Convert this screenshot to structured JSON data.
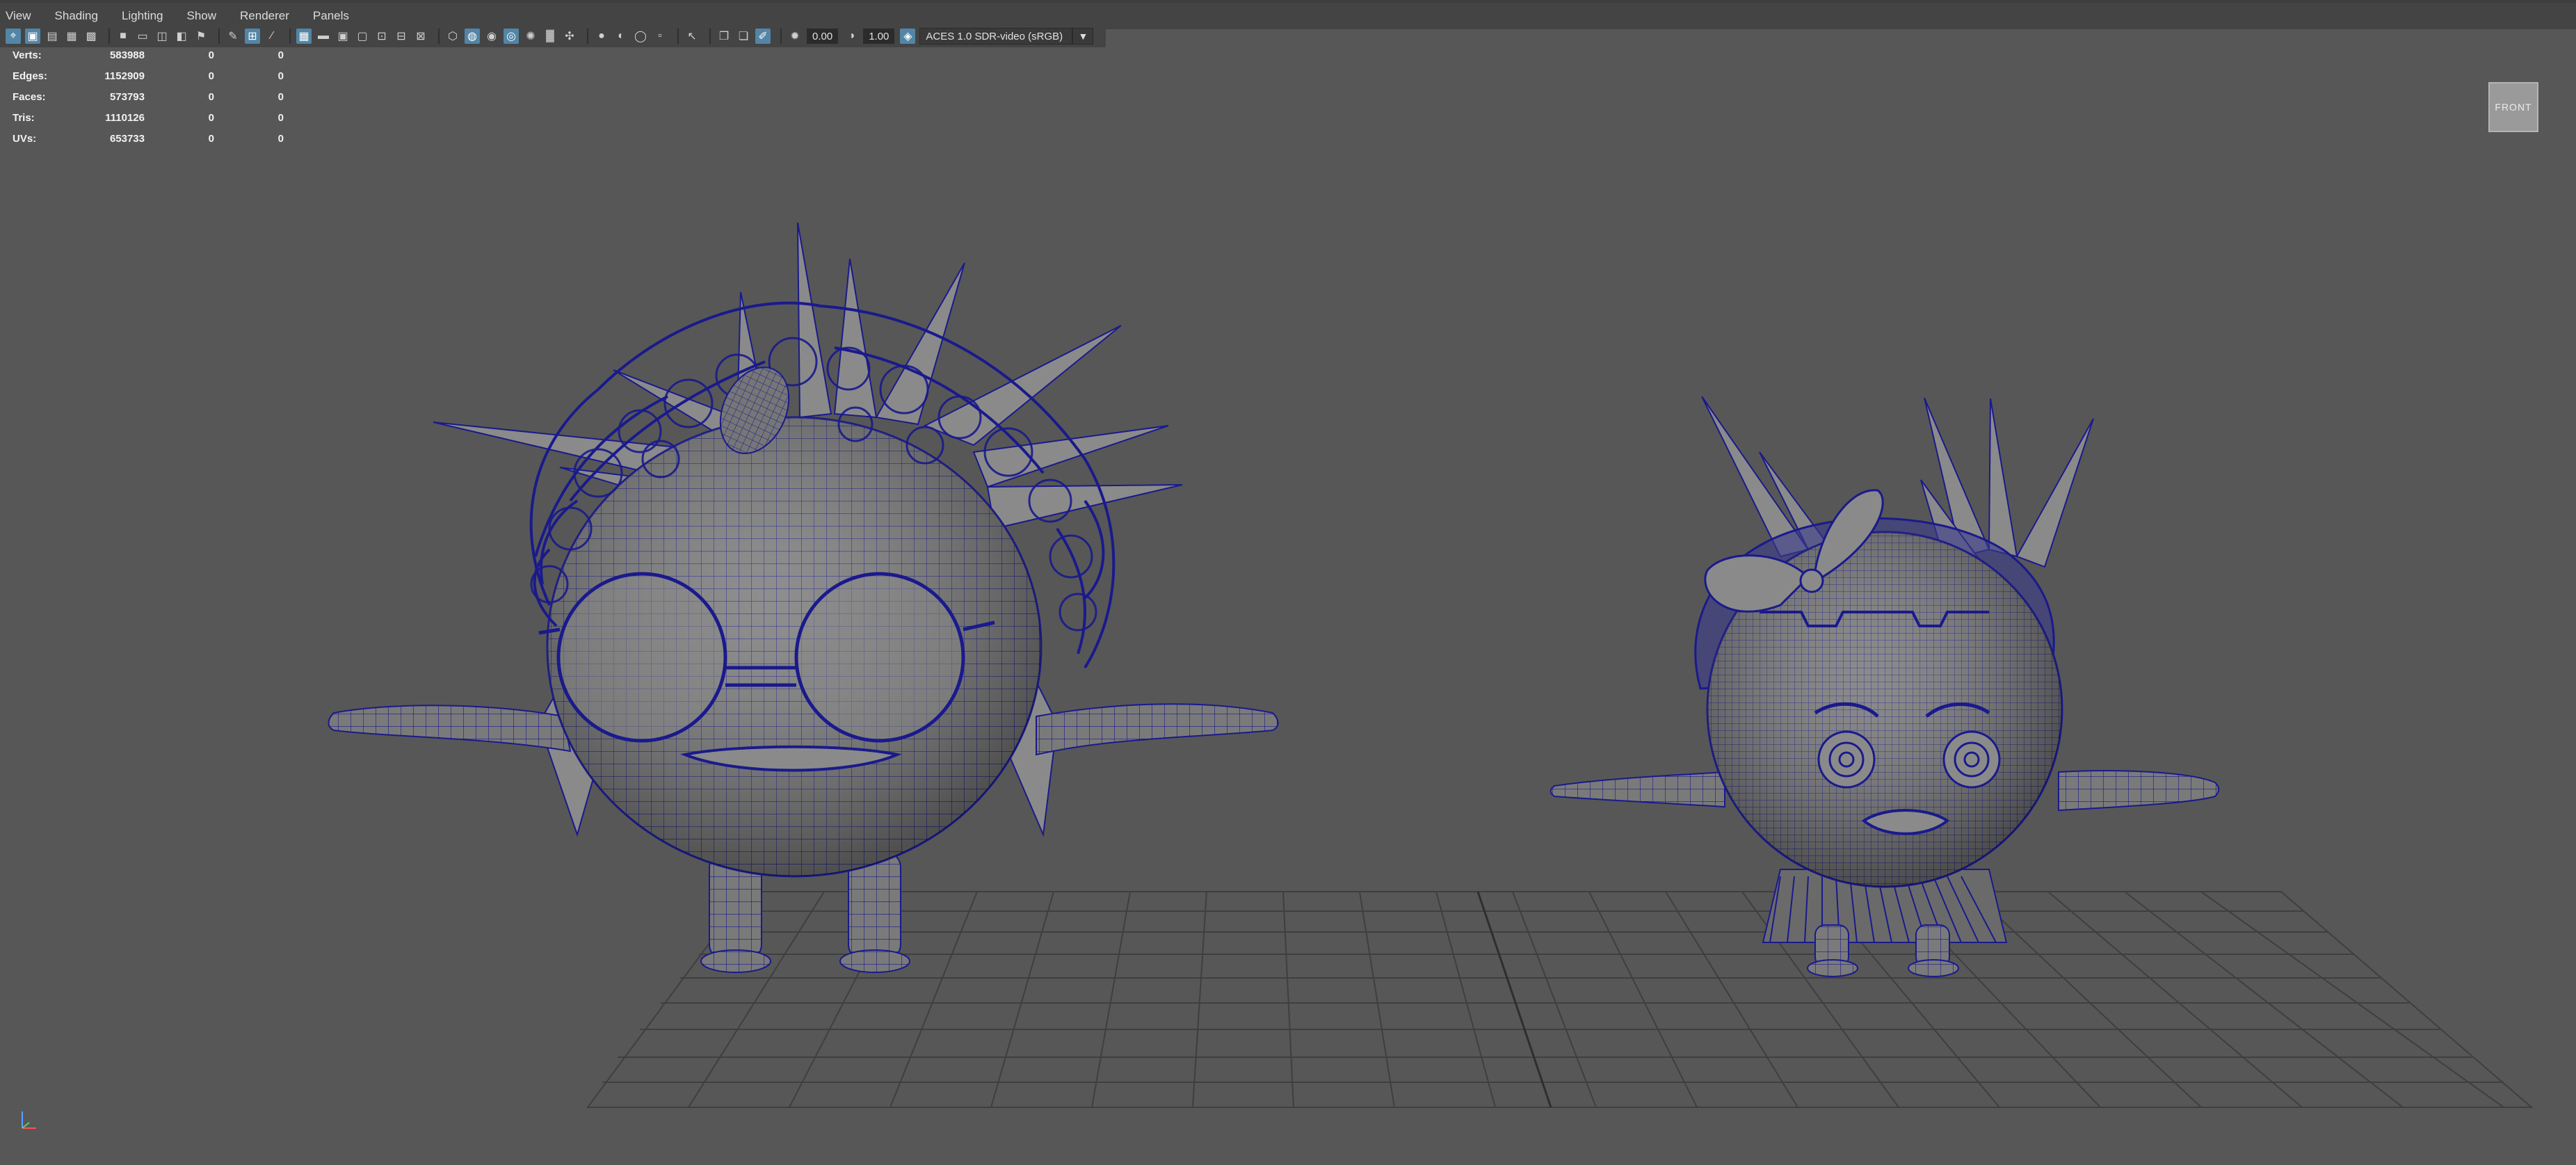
{
  "menu": [
    "View",
    "Shading",
    "Lighting",
    "Show",
    "Renderer",
    "Panels"
  ],
  "toolbar": {
    "exposure": "0.00",
    "gamma": "1.00",
    "color_space": "ACES 1.0 SDR-video (sRGB)",
    "icons": [
      "select-camera-icon",
      "camera-attributes-icon",
      "bookmarks-icon",
      "image-plane-icon",
      "grid-icon",
      "film-gate-icon",
      "resolution-gate-icon",
      "gate-mask-icon",
      "field-chart-icon",
      "safe-action-icon",
      "safe-title-icon",
      "wireframe-icon",
      "smooth-shade-icon",
      "default-material-icon",
      "textured-icon",
      "lights-icon",
      "shadows-icon",
      "screen-space-ao-icon",
      "motion-blur-icon",
      "anti-aliasing-icon",
      "isolate-select-icon",
      "xray-icon",
      "xray-joints-icon",
      "xray-components-icon"
    ]
  },
  "hud": {
    "rows": [
      {
        "label": "Verts:",
        "value": "583988",
        "sel": "0",
        "comp": "0"
      },
      {
        "label": "Edges:",
        "value": "1152909",
        "sel": "0",
        "comp": "0"
      },
      {
        "label": "Faces:",
        "value": "573793",
        "sel": "0",
        "comp": "0"
      },
      {
        "label": "Tris:",
        "value": "1110126",
        "sel": "0",
        "comp": "0"
      },
      {
        "label": "UVs:",
        "value": "653733",
        "sel": "0",
        "comp": "0"
      }
    ]
  },
  "viewcube": {
    "label": "FRONT"
  },
  "colors": {
    "viewport_bg": "#575757",
    "wireframe": "#1a1a8c",
    "mesh_shade": "#7a7a7a",
    "grid": "#3f3f3f",
    "active_button": "#5285a6"
  }
}
